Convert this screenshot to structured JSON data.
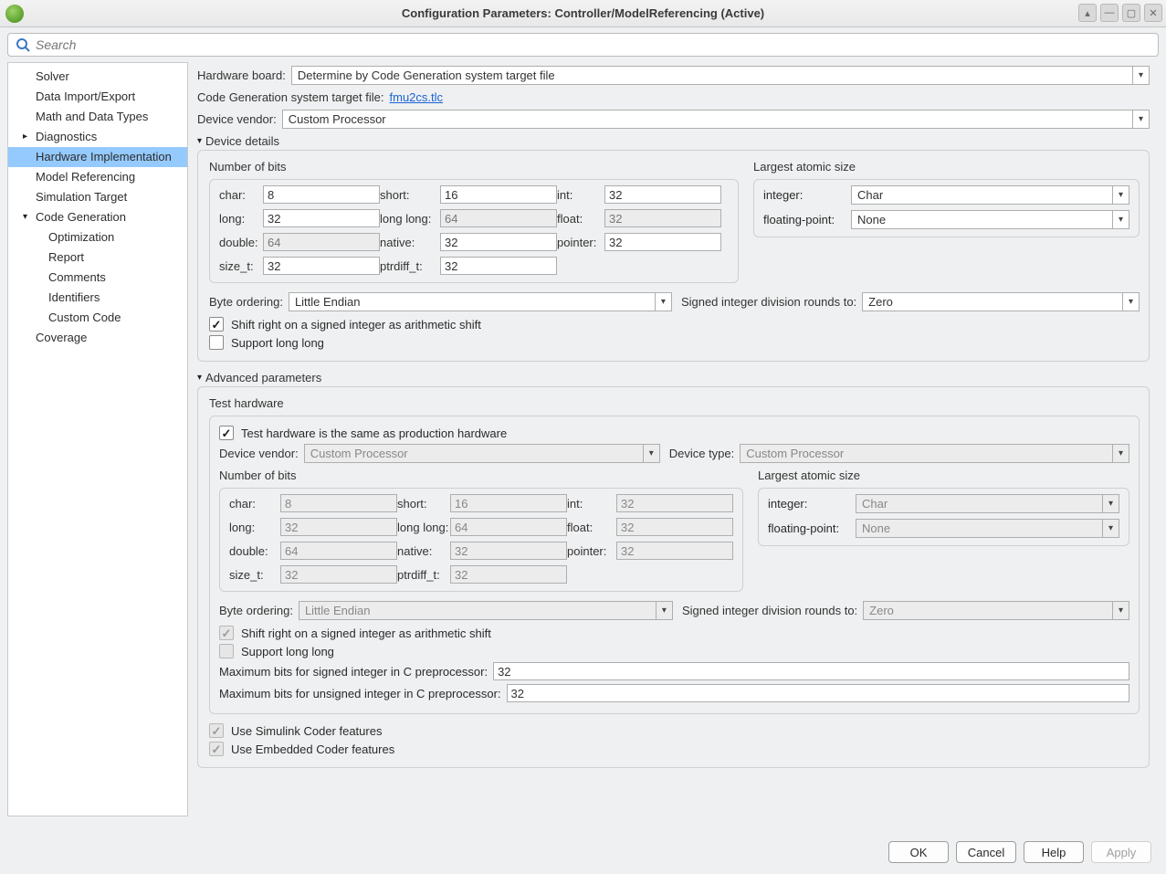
{
  "window": {
    "title": "Configuration Parameters: Controller/ModelReferencing (Active)"
  },
  "search": {
    "placeholder": "Search"
  },
  "tree": {
    "solver": "Solver",
    "data_import": "Data Import/Export",
    "math": "Math and Data Types",
    "diagnostics": "Diagnostics",
    "hw_impl": "Hardware Implementation",
    "model_ref": "Model Referencing",
    "sim_target": "Simulation Target",
    "code_gen": "Code Generation",
    "optimization": "Optimization",
    "report": "Report",
    "comments": "Comments",
    "identifiers": "Identifiers",
    "custom_code": "Custom Code",
    "coverage": "Coverage"
  },
  "labels": {
    "hw_board": "Hardware board:",
    "codegen_stf": "Code Generation system target file:",
    "device_vendor": "Device vendor:",
    "device_details": "Device details",
    "num_bits": "Number of bits",
    "largest_atomic": "Largest atomic size",
    "byte_ordering": "Byte ordering:",
    "sidr": "Signed integer division rounds to:",
    "shift_right": "Shift right on a signed integer as arithmetic shift",
    "support_ll": "Support long long",
    "advanced": "Advanced parameters",
    "test_hw": "Test hardware",
    "test_same": "Test hardware is the same as production hardware",
    "device_type": "Device type:",
    "max_signed": "Maximum bits for signed integer in C preprocessor:",
    "max_unsigned": "Maximum bits for unsigned integer in C preprocessor:",
    "use_simcoder": "Use Simulink Coder features",
    "use_embcoder": "Use Embedded Coder features",
    "char": "char:",
    "short": "short:",
    "int": "int:",
    "long": "long:",
    "longlong": "long long:",
    "float": "float:",
    "double": "double:",
    "native": "native:",
    "pointer": "pointer:",
    "size_t": "size_t:",
    "ptrdiff_t": "ptrdiff_t:",
    "integer": "integer:",
    "fp": "floating-point:"
  },
  "values": {
    "hw_board": "Determine by Code Generation system target file",
    "stf_link": "fmu2cs.tlc",
    "device_vendor": "Custom Processor",
    "bits": {
      "char": "8",
      "short": "16",
      "int": "32",
      "long": "32",
      "longlong": "64",
      "float": "32",
      "double": "64",
      "native": "32",
      "pointer": "32",
      "size_t": "32",
      "ptrdiff_t": "32"
    },
    "atomic_int": "Char",
    "atomic_fp": "None",
    "byte_ordering": "Little Endian",
    "sidr": "Zero",
    "test": {
      "device_vendor": "Custom Processor",
      "device_type": "Custom Processor",
      "bits": {
        "char": "8",
        "short": "16",
        "int": "32",
        "long": "32",
        "longlong": "64",
        "float": "32",
        "double": "64",
        "native": "32",
        "pointer": "32",
        "size_t": "32",
        "ptrdiff_t": "32"
      },
      "atomic_int": "Char",
      "atomic_fp": "None",
      "byte_ordering": "Little Endian",
      "sidr": "Zero"
    },
    "max_signed": "32",
    "max_unsigned": "32"
  },
  "buttons": {
    "ok": "OK",
    "cancel": "Cancel",
    "help": "Help",
    "apply": "Apply"
  }
}
